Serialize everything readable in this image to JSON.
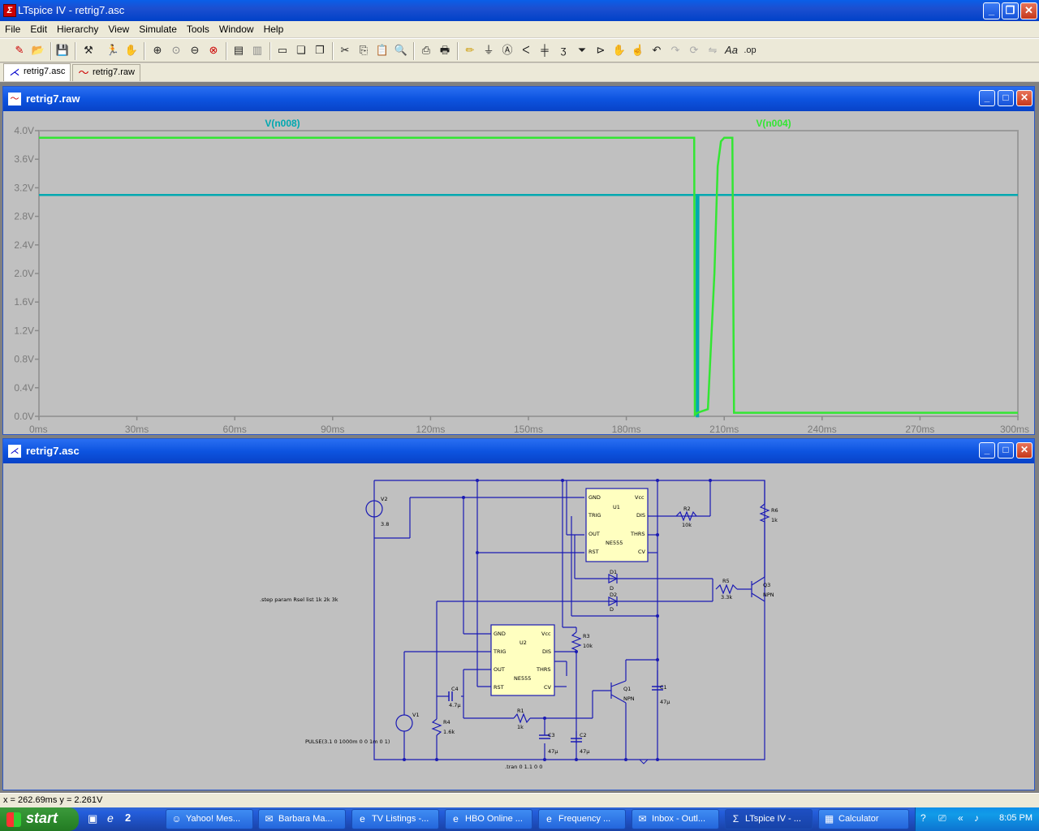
{
  "window": {
    "title": "LTspice IV - retrig7.asc",
    "app_icon": "LTspice-icon"
  },
  "menu": [
    "File",
    "Edit",
    "Hierarchy",
    "View",
    "Simulate",
    "Tools",
    "Window",
    "Help"
  ],
  "tabs": [
    {
      "label": "retrig7.asc",
      "icon": "schematic-icon",
      "active": true
    },
    {
      "label": "retrig7.raw",
      "icon": "waveform-icon",
      "active": false
    }
  ],
  "plot_window": {
    "title": "retrig7.raw"
  },
  "schematic_window": {
    "title": "retrig7.asc"
  },
  "chart_data": {
    "type": "line",
    "xlabel_unit": "ms",
    "x_ticks": [
      "0ms",
      "30ms",
      "60ms",
      "90ms",
      "120ms",
      "150ms",
      "180ms",
      "210ms",
      "240ms",
      "270ms",
      "300ms"
    ],
    "y_ticks": [
      "0.0V",
      "0.4V",
      "0.8V",
      "1.2V",
      "1.6V",
      "2.0V",
      "2.4V",
      "2.8V",
      "3.2V",
      "3.6V",
      "4.0V"
    ],
    "xlim": [
      0,
      300
    ],
    "ylim": [
      0,
      4.0
    ],
    "grid": false,
    "series": [
      {
        "name": "V(n008)",
        "color": "#00a8b0",
        "x": [
          0,
          201.5,
          201.6,
          202.0,
          202.1,
          300
        ],
        "y": [
          3.1,
          3.1,
          0.0,
          0.0,
          3.1,
          3.1
        ]
      },
      {
        "name": "V(n004)",
        "color": "#33e633",
        "x": [
          0,
          200.8,
          201.0,
          201.8,
          205.0,
          207.0,
          208.0,
          209.0,
          210.0,
          212.5,
          213.0,
          214.0,
          300
        ],
        "y": [
          3.9,
          3.9,
          0.02,
          0.05,
          0.1,
          2.0,
          3.5,
          3.85,
          3.9,
          3.9,
          0.05,
          0.05,
          0.05
        ]
      }
    ]
  },
  "schematic": {
    "directive_step": ".step param Rsel list 1k 2k 3k",
    "directive_tran": ".tran 0 1.1 0 0",
    "pulse_value": "PULSE(3.1 0 1000m 0 0 1m 0 1)",
    "components": {
      "V2": {
        "name": "V2",
        "value": "3.8"
      },
      "V1": {
        "name": "V1"
      },
      "U1": {
        "name": "U1",
        "type": "NE555",
        "pins": [
          "GND",
          "Vcc",
          "TRIG",
          "DIS",
          "OUT",
          "THRS",
          "RST",
          "CV"
        ]
      },
      "U2": {
        "name": "U2",
        "type": "NE555",
        "pins": [
          "GND",
          "Vcc",
          "TRIG",
          "DIS",
          "OUT",
          "THRS",
          "RST",
          "CV"
        ]
      },
      "R2": {
        "name": "R2",
        "value": "10k"
      },
      "R6": {
        "name": "R6",
        "value": "1k"
      },
      "R5": {
        "name": "R5",
        "value": "3.3k"
      },
      "R3": {
        "name": "R3",
        "value": "10k"
      },
      "R1": {
        "name": "R1",
        "value": "1k"
      },
      "R4": {
        "name": "R4",
        "value": "1.6k"
      },
      "D1": {
        "name": "D1",
        "value": "D"
      },
      "D2": {
        "name": "D2",
        "value": "D"
      },
      "Q3": {
        "name": "Q3",
        "value": "NPN"
      },
      "Q1": {
        "name": "Q1",
        "value": "NPN"
      },
      "C1": {
        "name": "C1",
        "value": "47µ"
      },
      "C2": {
        "name": "C2",
        "value": "47µ"
      },
      "C3": {
        "name": "C3",
        "value": "47µ"
      },
      "C4": {
        "name": "C4",
        "value": "4.7µ"
      }
    }
  },
  "status": {
    "readout": "x = 262.69ms    y = 2.261V"
  },
  "taskbar": {
    "start_label": "start",
    "buttons": [
      {
        "label": "Yahoo! Mes...",
        "icon": "yahoo-icon"
      },
      {
        "label": "Barbara Ma...",
        "icon": "app-icon"
      },
      {
        "label": "TV Listings -...",
        "icon": "ie-icon"
      },
      {
        "label": "HBO Online ...",
        "icon": "ie-icon"
      },
      {
        "label": "Frequency ...",
        "icon": "ie-icon"
      },
      {
        "label": "Inbox - Outl...",
        "icon": "outlook-icon"
      },
      {
        "label": "LTspice IV - ...",
        "icon": "ltspice-icon",
        "active": true
      },
      {
        "label": "Calculator",
        "icon": "calculator-icon"
      }
    ],
    "quicklaunch_badge": "2",
    "clock": "8:05 PM"
  }
}
